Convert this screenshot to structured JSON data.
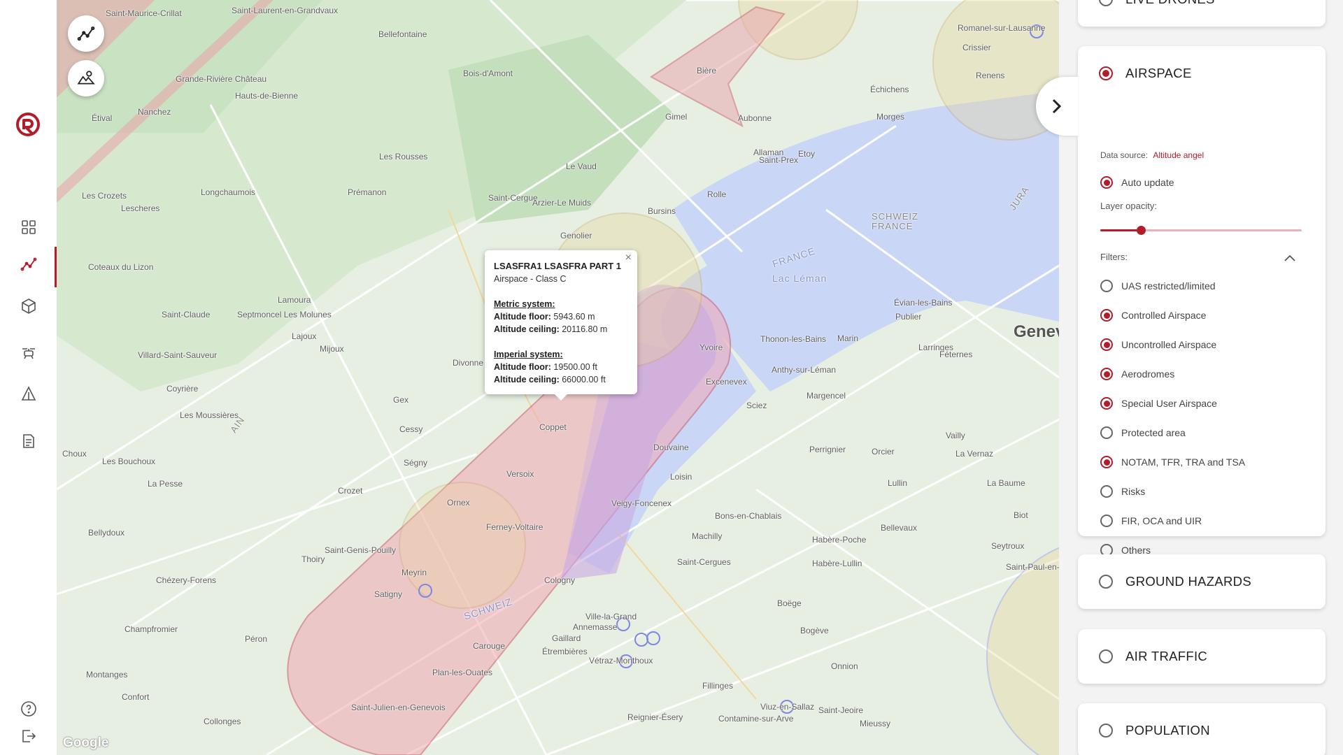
{
  "nav": {
    "items": [
      {
        "name": "dashboard",
        "icon": "grid-icon"
      },
      {
        "name": "flight-routes",
        "icon": "route-icon",
        "active": true
      },
      {
        "name": "3d-models",
        "icon": "cube-icon"
      },
      {
        "name": "drones",
        "icon": "drone-icon"
      },
      {
        "name": "alerts",
        "icon": "warning-icon"
      },
      {
        "name": "reports",
        "icon": "document-icon"
      }
    ],
    "bottom": [
      {
        "name": "help",
        "icon": "help-icon"
      },
      {
        "name": "logout",
        "icon": "logout-icon"
      }
    ]
  },
  "map": {
    "labels": [
      {
        "text": "Saint-Maurice-Crillat",
        "cls": ""
      },
      {
        "text": "Saint-Laurent-en-Grandvaux",
        "cls": ""
      },
      {
        "text": "Bellefontaine",
        "cls": ""
      },
      {
        "text": "Grande-Rivière Château",
        "cls": ""
      },
      {
        "text": "Étival",
        "cls": ""
      },
      {
        "text": "Nanchez",
        "cls": ""
      },
      {
        "text": "Bois-d'Amont",
        "cls": ""
      },
      {
        "text": "Hauts-de-Bienne",
        "cls": ""
      },
      {
        "text": "Les Rousses",
        "cls": ""
      },
      {
        "text": "Le Vaud",
        "cls": ""
      },
      {
        "text": "Gimel",
        "cls": ""
      },
      {
        "text": "Bière",
        "cls": ""
      },
      {
        "text": "Aubonne",
        "cls": ""
      },
      {
        "text": "Etoy",
        "cls": ""
      },
      {
        "text": "Allaman",
        "cls": ""
      },
      {
        "text": "Rolle",
        "cls": ""
      },
      {
        "text": "Bursins",
        "cls": ""
      },
      {
        "text": "Saint-Prex",
        "cls": ""
      },
      {
        "text": "Morges",
        "cls": ""
      },
      {
        "text": "Échichens",
        "cls": ""
      },
      {
        "text": "Crissier",
        "cls": ""
      },
      {
        "text": "Renens",
        "cls": ""
      },
      {
        "text": "Romanel-sur-Lausanne",
        "cls": ""
      },
      {
        "text": "Les Crozets",
        "cls": ""
      },
      {
        "text": "Lescheres",
        "cls": ""
      },
      {
        "text": "Longchaumois",
        "cls": ""
      },
      {
        "text": "Prémanon",
        "cls": ""
      },
      {
        "text": "Saint-Cergue",
        "cls": ""
      },
      {
        "text": "Arzier-Le Muids",
        "cls": ""
      },
      {
        "text": "Genolier",
        "cls": ""
      },
      {
        "text": "Coteaux du Lizon",
        "cls": ""
      },
      {
        "text": "Lamoura",
        "cls": ""
      },
      {
        "text": "Septmoncel Les Molunes",
        "cls": ""
      },
      {
        "text": "Lajoux",
        "cls": ""
      },
      {
        "text": "Mijoux",
        "cls": ""
      },
      {
        "text": "Saint-Claude",
        "cls": ""
      },
      {
        "text": "Villard-Saint-Sauveur",
        "cls": ""
      },
      {
        "text": "Divonne",
        "cls": ""
      },
      {
        "text": "Gex",
        "cls": ""
      },
      {
        "text": "Cessy",
        "cls": ""
      },
      {
        "text": "Ségny",
        "cls": ""
      },
      {
        "text": "Crozet",
        "cls": ""
      },
      {
        "text": "Ornex",
        "cls": ""
      },
      {
        "text": "Versoix",
        "cls": ""
      },
      {
        "text": "Coppet",
        "cls": ""
      },
      {
        "text": "Ferney-Voltaire",
        "cls": ""
      },
      {
        "text": "Saint-Genis-Pouilly",
        "cls": ""
      },
      {
        "text": "Thoiry",
        "cls": ""
      },
      {
        "text": "Meyrin",
        "cls": ""
      },
      {
        "text": "Satigny",
        "cls": ""
      },
      {
        "text": "Cologny",
        "cls": ""
      },
      {
        "text": "Carouge",
        "cls": ""
      },
      {
        "text": "Plan-les-Ouates",
        "cls": ""
      },
      {
        "text": "Saint-Julien-en-Genevois",
        "cls": ""
      },
      {
        "text": "Collonges",
        "cls": ""
      },
      {
        "text": "Péron",
        "cls": ""
      },
      {
        "text": "Chézery-Forens",
        "cls": ""
      },
      {
        "text": "Champfromier",
        "cls": ""
      },
      {
        "text": "Montanges",
        "cls": ""
      },
      {
        "text": "Confort",
        "cls": ""
      },
      {
        "text": "Les Bouchoux",
        "cls": ""
      },
      {
        "text": "La Pesse",
        "cls": ""
      },
      {
        "text": "Les Moussières",
        "cls": ""
      },
      {
        "text": "Coyrière",
        "cls": ""
      },
      {
        "text": "Bellydoux",
        "cls": ""
      },
      {
        "text": "Choux",
        "cls": ""
      },
      {
        "text": "Douvaine",
        "cls": ""
      },
      {
        "text": "Loisin",
        "cls": ""
      },
      {
        "text": "Veigy-Foncenex",
        "cls": ""
      },
      {
        "text": "Bons-en-Chablais",
        "cls": ""
      },
      {
        "text": "Machilly",
        "cls": ""
      },
      {
        "text": "Saint-Cergues",
        "cls": ""
      },
      {
        "text": "Ville-la-Grand",
        "cls": ""
      },
      {
        "text": "Annemasse",
        "cls": ""
      },
      {
        "text": "Vétraz-Monthoux",
        "cls": ""
      },
      {
        "text": "Gaillard",
        "cls": ""
      },
      {
        "text": "Étrembières",
        "cls": ""
      },
      {
        "text": "Reignier-Ésery",
        "cls": ""
      },
      {
        "text": "Fillinges",
        "cls": ""
      },
      {
        "text": "Contamine-sur-Arve",
        "cls": ""
      },
      {
        "text": "Boëge",
        "cls": ""
      },
      {
        "text": "Bogève",
        "cls": ""
      },
      {
        "text": "Onnion",
        "cls": ""
      },
      {
        "text": "Mieussy",
        "cls": ""
      },
      {
        "text": "Saint-Jeoire",
        "cls": ""
      },
      {
        "text": "Viuz-en-Sallaz",
        "cls": ""
      },
      {
        "text": "Habère-Poche",
        "cls": ""
      },
      {
        "text": "Habère-Lullin",
        "cls": ""
      },
      {
        "text": "Bellevaux",
        "cls": ""
      },
      {
        "text": "Lullin",
        "cls": ""
      },
      {
        "text": "Perrignier",
        "cls": ""
      },
      {
        "text": "Orcier",
        "cls": ""
      },
      {
        "text": "Vailly",
        "cls": ""
      },
      {
        "text": "Margencel",
        "cls": ""
      },
      {
        "text": "Sciez",
        "cls": ""
      },
      {
        "text": "Excenevex",
        "cls": ""
      },
      {
        "text": "Yvoire",
        "cls": ""
      },
      {
        "text": "Anthy-sur-Léman",
        "cls": ""
      },
      {
        "text": "Thonon-les-Bains",
        "cls": ""
      },
      {
        "text": "Marin",
        "cls": ""
      },
      {
        "text": "Publier",
        "cls": ""
      },
      {
        "text": "Évian-les-Bains",
        "cls": ""
      },
      {
        "text": "Larringes",
        "cls": ""
      },
      {
        "text": "Féternes",
        "cls": ""
      },
      {
        "text": "La Vernaz",
        "cls": ""
      },
      {
        "text": "La Baume",
        "cls": ""
      },
      {
        "text": "Biot",
        "cls": ""
      },
      {
        "text": "Seytroux",
        "cls": ""
      },
      {
        "text": "Saint-Paul-en-Chablais",
        "cls": ""
      },
      {
        "text": "Geneva",
        "cls": "city"
      },
      {
        "text": "SCHWEIZ",
        "cls": "water"
      },
      {
        "text": "FRANCE",
        "cls": "water"
      },
      {
        "text": "Lac Léman",
        "cls": "water"
      },
      {
        "text": "SCHWEIZ FRANCE",
        "cls": "border"
      },
      {
        "text": "JURA",
        "cls": "border"
      },
      {
        "text": "AIN",
        "cls": "border"
      }
    ],
    "buttons": [
      {
        "name": "route-tool-button",
        "icon": "route-icon"
      },
      {
        "name": "terrain-tool-button",
        "icon": "terrain-icon"
      }
    ],
    "google": "Google"
  },
  "popup": {
    "title": "LSASFRA1 LSASFRA PART 1",
    "subtitle": "Airspace - Class C",
    "metric_head": "Metric system:",
    "floor_label": "Altitude floor:",
    "floor_m": "5943.60 m",
    "ceiling_label": "Altitude ceiling:",
    "ceiling_m": "20116.80 m",
    "imperial_head": "Imperial system:",
    "floor_ft": "19500.00 ft",
    "ceiling_ft": "66000.00 ft"
  },
  "panel": {
    "live_drones": {
      "label": "LIVE DRONES",
      "selected": false
    },
    "airspace": {
      "label": "AIRSPACE",
      "selected": true,
      "data_source_label": "Data source:",
      "data_source_value": "Altitude angel",
      "auto_update_label": "Auto update",
      "auto_update": true,
      "opacity_label": "Layer opacity:",
      "opacity": 0.2,
      "filters_label": "Filters:",
      "filters": [
        {
          "label": "UAS restricted/limited",
          "selected": false
        },
        {
          "label": "Controlled Airspace",
          "selected": true
        },
        {
          "label": "Uncontrolled Airspace",
          "selected": true
        },
        {
          "label": "Aerodromes",
          "selected": true
        },
        {
          "label": "Special User Airspace",
          "selected": true
        },
        {
          "label": "Protected area",
          "selected": false
        },
        {
          "label": "NOTAM, TFR, TRA and TSA",
          "selected": true
        },
        {
          "label": "Risks",
          "selected": false
        },
        {
          "label": "FIR, OCA and UIR",
          "selected": false
        },
        {
          "label": "Others",
          "selected": false
        }
      ]
    },
    "ground_hazards": {
      "label": "GROUND HAZARDS",
      "selected": false
    },
    "air_traffic": {
      "label": "AIR TRAFFIC",
      "selected": false
    },
    "population": {
      "label": "POPULATION",
      "selected": false
    }
  },
  "colors": {
    "accent": "#b11d2a",
    "water": "#c9d6f5",
    "zone_red": "#e9a3ac",
    "zone_purple": "#c9a8e3",
    "zone_yellow": "#d9c47d"
  }
}
